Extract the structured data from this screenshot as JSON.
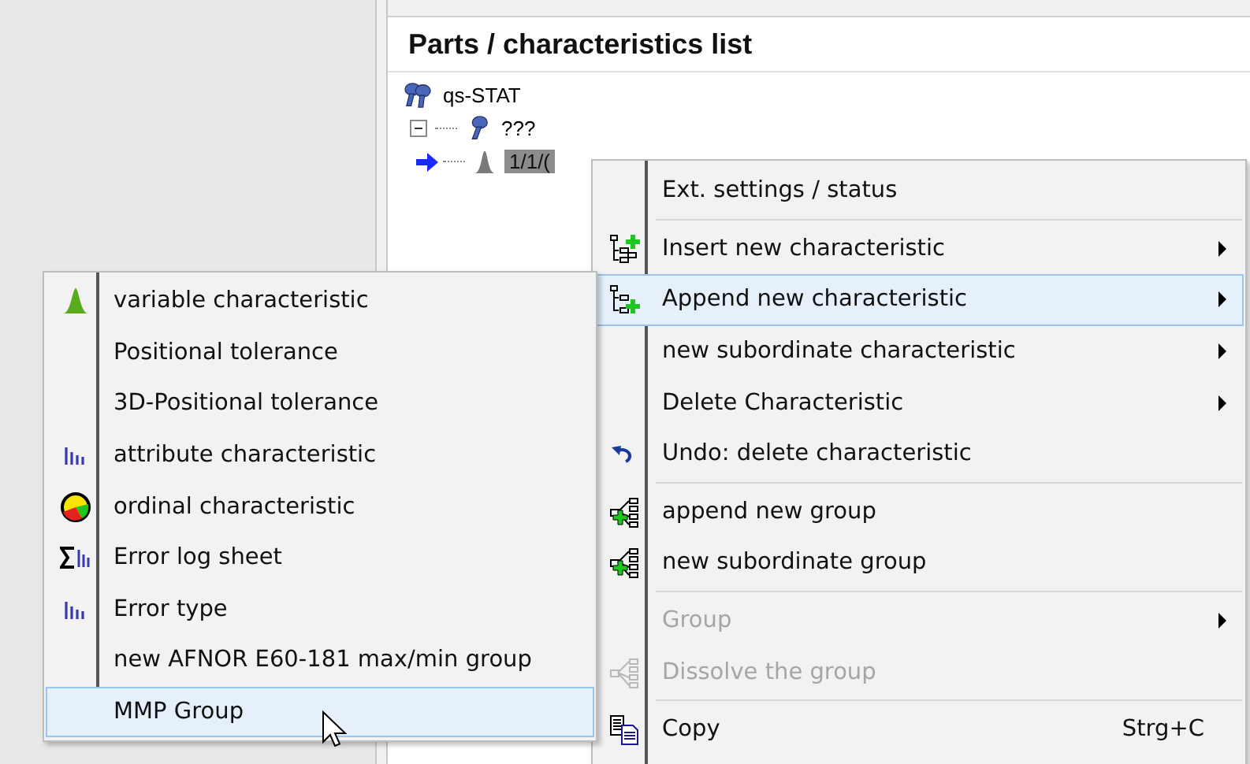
{
  "panel": {
    "title": "Parts / characteristics list"
  },
  "tree": [
    {
      "label": "qs-STAT",
      "selected": false,
      "children": [
        {
          "label": "???",
          "selected": false,
          "expanded": true,
          "children": [
            {
              "label": "1/1/(",
              "selected": true,
              "current": true
            }
          ]
        }
      ]
    }
  ],
  "context_menu": [
    {
      "kind": "item",
      "label": "Ext. settings / status",
      "selected": false,
      "disabled": false,
      "submenu": false
    },
    {
      "kind": "separator"
    },
    {
      "kind": "item",
      "label": "Insert new characteristic",
      "selected": false,
      "disabled": false,
      "submenu": true
    },
    {
      "kind": "item",
      "label": "Append new characteristic",
      "selected": true,
      "disabled": false,
      "submenu": true
    },
    {
      "kind": "item",
      "label": "new subordinate characteristic",
      "selected": false,
      "disabled": false,
      "submenu": true
    },
    {
      "kind": "item",
      "label": "Delete Characteristic",
      "selected": false,
      "disabled": false,
      "submenu": true
    },
    {
      "kind": "item",
      "label": "Undo: delete characteristic",
      "selected": false,
      "disabled": false,
      "submenu": false
    },
    {
      "kind": "separator"
    },
    {
      "kind": "item",
      "label": "append new group",
      "selected": false,
      "disabled": false,
      "submenu": false
    },
    {
      "kind": "item",
      "label": "new subordinate group",
      "selected": false,
      "disabled": false,
      "submenu": false
    },
    {
      "kind": "separator"
    },
    {
      "kind": "item",
      "label": "Group",
      "selected": false,
      "disabled": true,
      "submenu": true
    },
    {
      "kind": "item",
      "label": "Dissolve the group",
      "selected": false,
      "disabled": true,
      "submenu": false
    },
    {
      "kind": "separator"
    },
    {
      "kind": "item",
      "label": "Copy",
      "shortcut": "Strg+C",
      "selected": false,
      "disabled": false,
      "submenu": false
    }
  ],
  "submenu": [
    {
      "label": "variable characteristic",
      "selected": false
    },
    {
      "label": "Positional tolerance",
      "selected": false
    },
    {
      "label": "3D-Positional tolerance",
      "selected": false
    },
    {
      "label": "attribute characteristic",
      "selected": false
    },
    {
      "label": "ordinal characteristic",
      "selected": false
    },
    {
      "label": "Error log sheet",
      "selected": false
    },
    {
      "label": "Error type",
      "selected": false
    },
    {
      "label": "new AFNOR E60-181 max/min group",
      "selected": false
    },
    {
      "label": "MMP Group",
      "selected": true
    }
  ]
}
